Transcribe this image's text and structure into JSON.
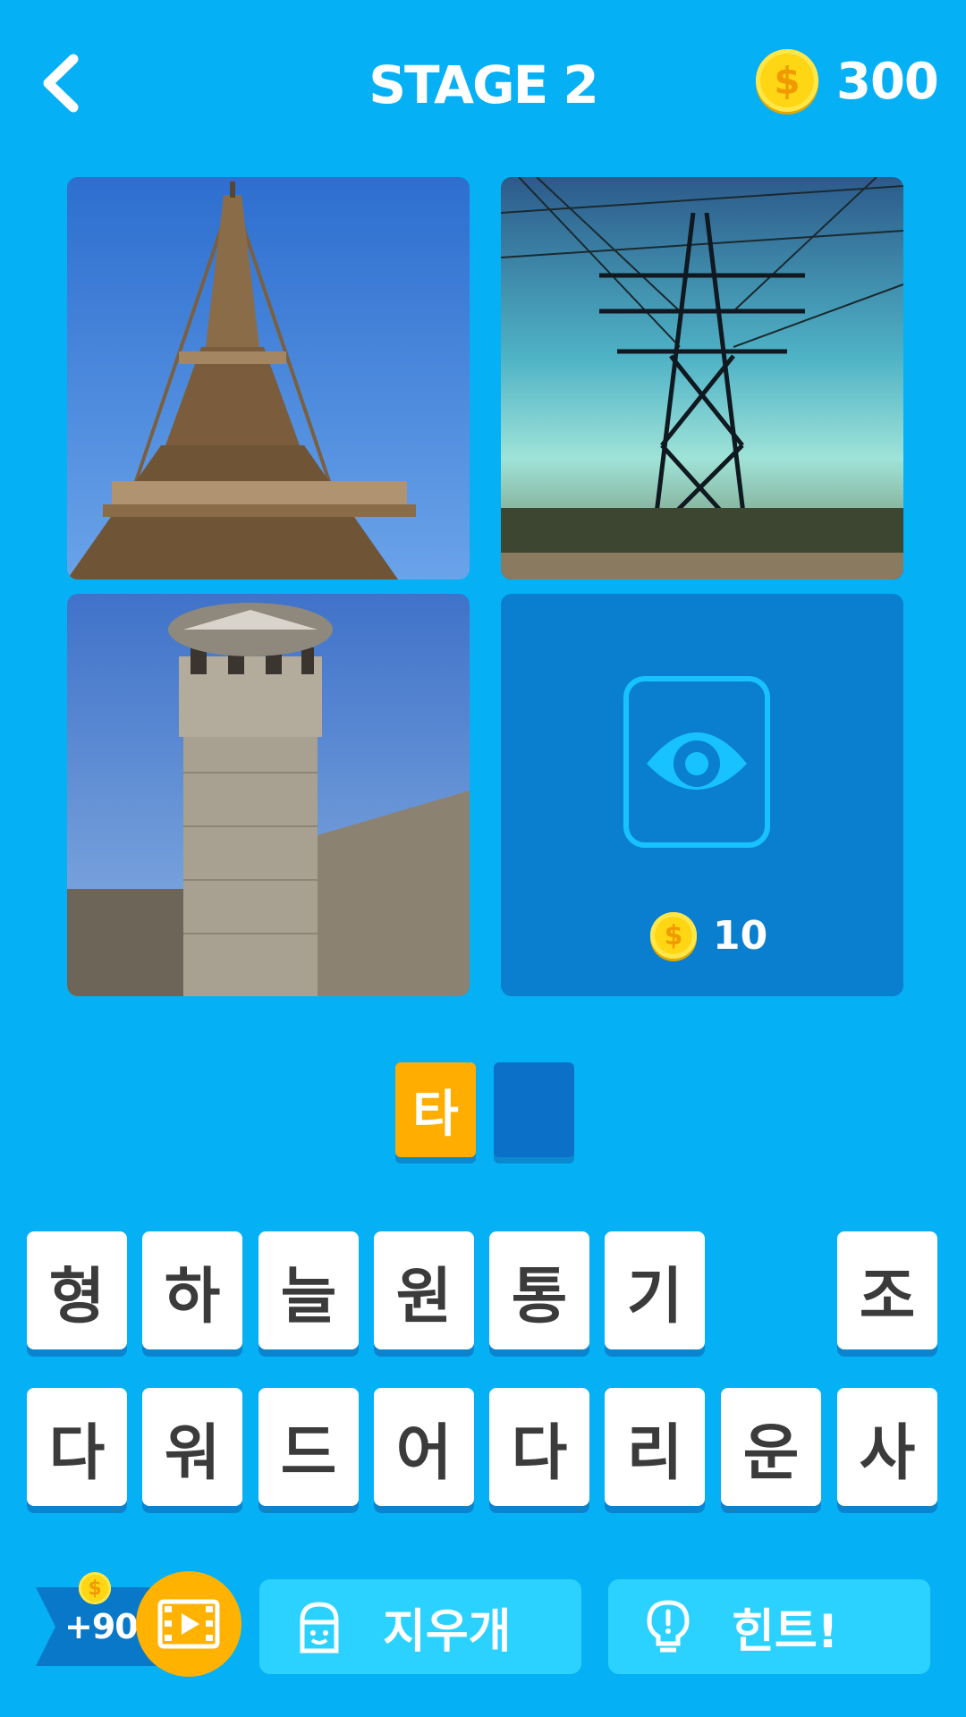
{
  "header": {
    "title": "STAGE 2",
    "coins": "300",
    "coin_symbol": "$"
  },
  "tiles": [
    {
      "name": "eiffel-tower-photo"
    },
    {
      "name": "power-pylon-photo"
    },
    {
      "name": "stone-tower-photo"
    }
  ],
  "reveal": {
    "cost": "10",
    "coin_symbol": "$"
  },
  "answer": {
    "filled": "타"
  },
  "keyboard": {
    "row1": [
      "형",
      "하",
      "늘",
      "원",
      "통",
      "기",
      "",
      "조"
    ],
    "row2": [
      "다",
      "워",
      "드",
      "어",
      "다",
      "리",
      "운",
      "사"
    ]
  },
  "footer": {
    "reward": "+90",
    "coin_symbol": "$",
    "eraser_label": "지우개",
    "hint_label": "힌트!"
  },
  "colors": {
    "background": "#05b0f5",
    "key_shadow": "#0a84cf",
    "accent": "#ffae00"
  }
}
